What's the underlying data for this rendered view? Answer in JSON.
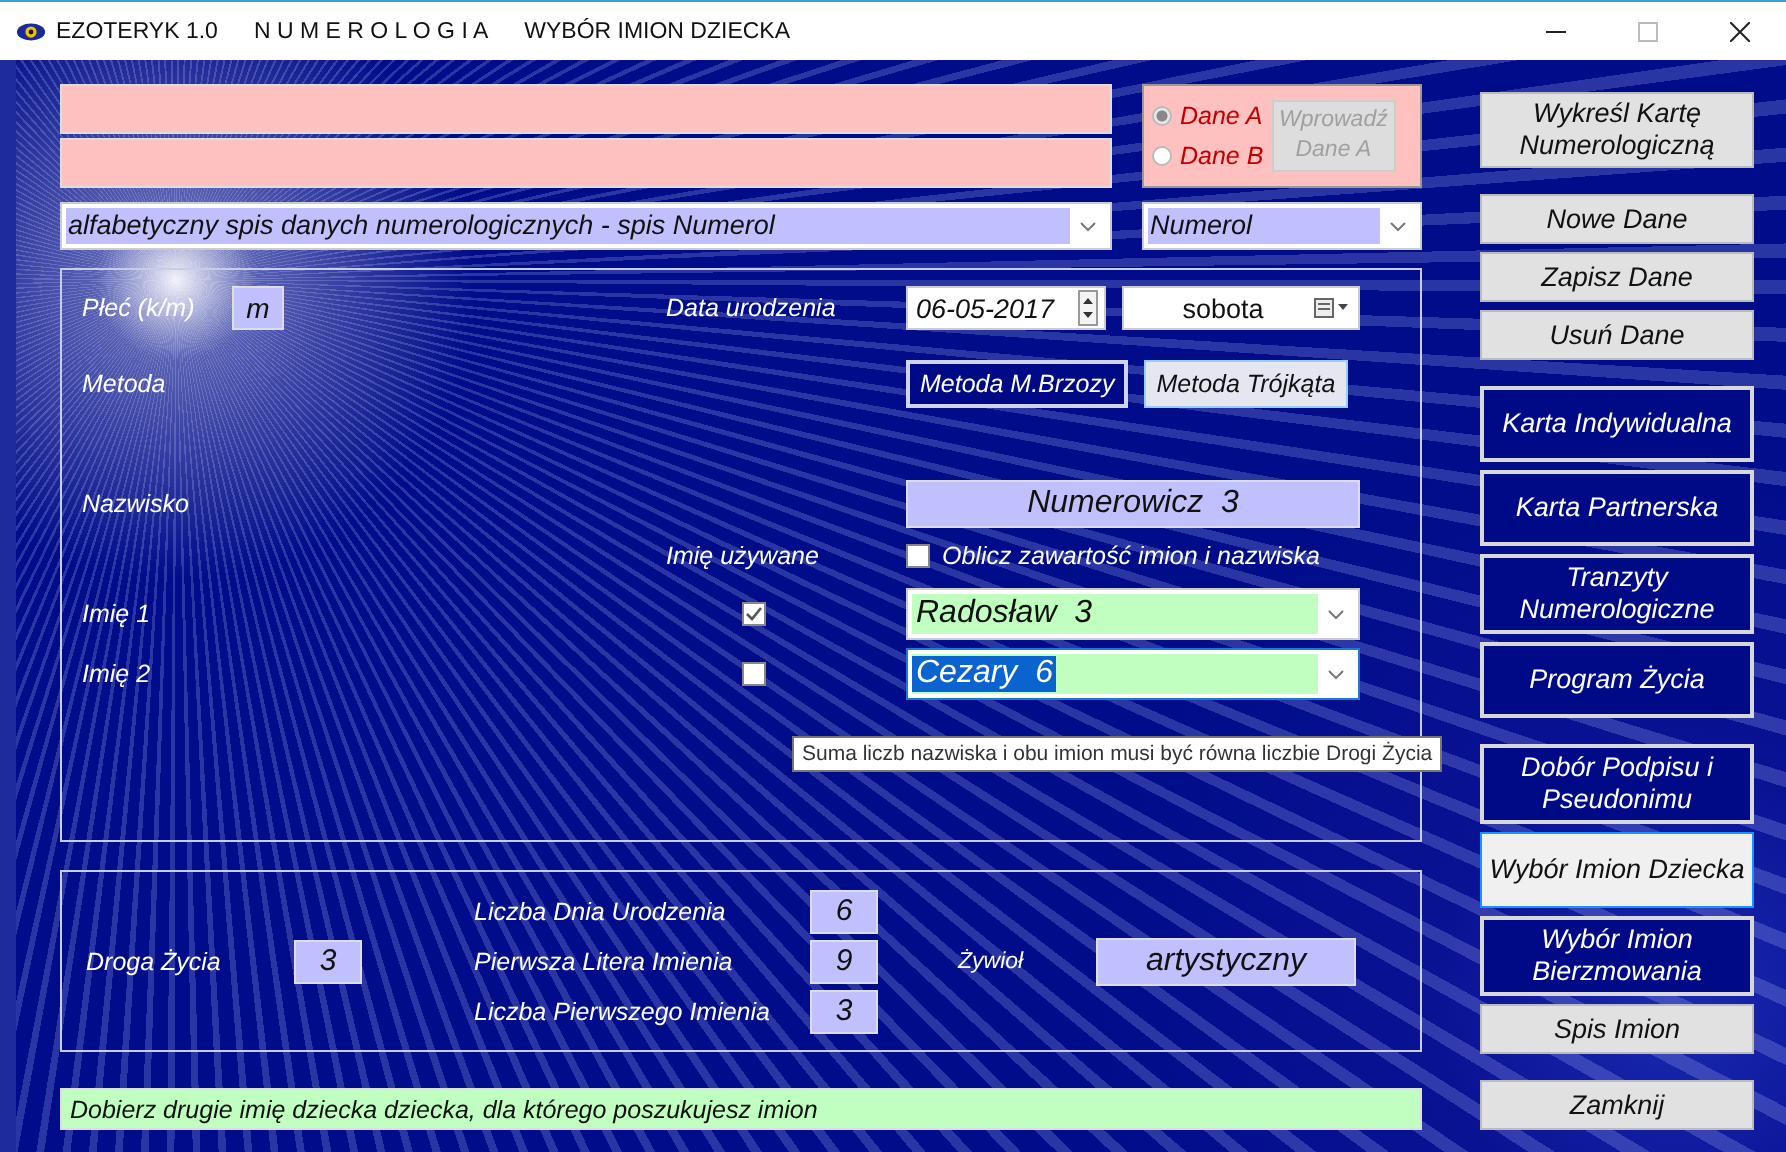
{
  "window": {
    "app": "EZOTERYK 1.0",
    "module": "N U M E R O L O G I A",
    "title": "WYBÓR IMION DZIECKA"
  },
  "data_set": {
    "options": [
      {
        "label": "Dane A",
        "selected": true
      },
      {
        "label": "Dane B",
        "selected": false
      }
    ],
    "button": {
      "label": "Wprowadź Dane A",
      "disabled": true
    }
  },
  "list_select": {
    "value": "alfabetyczny spis danych numerologicznych - spis Numerol"
  },
  "db_select": {
    "value": "Numerol"
  },
  "form": {
    "gender_label": "Płeć (k/m)",
    "gender": "m",
    "birth_label": "Data urodzenia",
    "birth_date": "06-05-2017",
    "weekday": "sobota",
    "method_label": "Metoda",
    "methods": [
      {
        "label": "Metoda M.Brzozy",
        "selected": true
      },
      {
        "label": "Metoda Trójkąta",
        "selected": false
      }
    ],
    "surname_label": "Nazwisko",
    "surname": "Numerowicz  3",
    "used_name_label": "Imię używane",
    "compute": {
      "label": "Oblicz zawartość imion i nazwiska",
      "checked": false
    },
    "names": [
      {
        "label": "Imię 1",
        "used": true,
        "value": "Radosław  3",
        "selected": false
      },
      {
        "label": "Imię 2",
        "used": false,
        "value": "Cezary  6",
        "selected": true
      }
    ]
  },
  "tooltip": "Suma liczb nazwiska i obu imion musi być równa liczbie Drogi Życia",
  "summary": {
    "life_path_label": "Droga Życia",
    "life_path": "3",
    "numbers": [
      {
        "label": "Liczba Dnia Urodzenia",
        "value": "6"
      },
      {
        "label": "Pierwsza Litera Imienia",
        "value": "9"
      },
      {
        "label": "Liczba Pierwszego Imienia",
        "value": "3"
      }
    ],
    "element_label": "Żywioł",
    "element": "artystyczny"
  },
  "status": "Dobierz drugie imię dziecka dziecka, dla którego poszukujesz imion",
  "button_groups": [
    [
      {
        "label": "Wykreśl Kartę Numerologiczną",
        "kind": "grey",
        "selected": false
      }
    ],
    [
      {
        "label": "Nowe Dane",
        "kind": "grey",
        "selected": false
      },
      {
        "label": "Zapisz Dane",
        "kind": "grey",
        "selected": false
      },
      {
        "label": "Usuń Dane",
        "kind": "grey",
        "selected": false
      }
    ],
    [
      {
        "label": "Karta Indywidualna",
        "kind": "dark",
        "selected": false
      },
      {
        "label": "Karta Partnerska",
        "kind": "dark",
        "selected": false
      },
      {
        "label": "Tranzyty Numerologiczne",
        "kind": "dark",
        "selected": false
      },
      {
        "label": "Program Życia",
        "kind": "dark",
        "selected": false
      }
    ],
    [
      {
        "label": "Dobór Podpisu i Pseudonimu",
        "kind": "dark",
        "selected": false
      },
      {
        "label": "Wybór Imion Dziecka",
        "kind": "light",
        "selected": true
      },
      {
        "label": "Wybór Imion Bierzmowania",
        "kind": "dark",
        "selected": false
      },
      {
        "label": "Spis Imion",
        "kind": "grey",
        "selected": false
      }
    ],
    [
      {
        "label": "Zamknij",
        "kind": "grey",
        "selected": false
      }
    ]
  ]
}
